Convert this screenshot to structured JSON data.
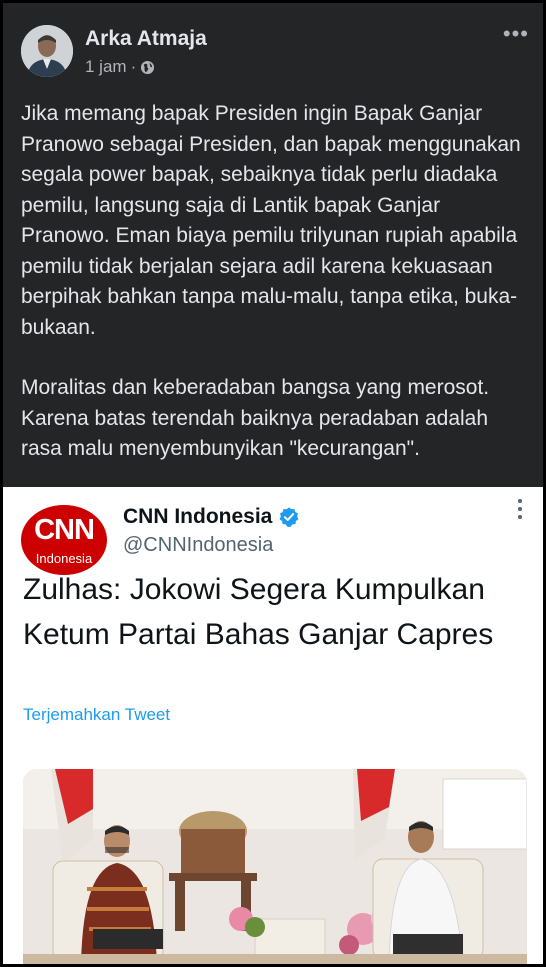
{
  "post": {
    "author": "Arka Atmaja",
    "time": "1 jam",
    "separator": "·",
    "privacy_icon": "public-globe-icon",
    "more_label": "•••",
    "paragraphs": [
      "Jika memang bapak Presiden ingin Bapak Ganjar Pranowo sebagai Presiden, dan bapak menggunakan segala power bapak, sebaiknya tidak perlu diadaka pemilu, langsung saja di Lantik bapak Ganjar Pranowo. Eman biaya pemilu trilyunan rupiah apabila pemilu tidak berjalan sejara adil karena kekuasaan berpihak bahkan tanpa malu-malu, tanpa etika, buka-bukaan.",
      "Moralitas dan keberadaban bangsa yang merosot. Karena batas terendah baiknya peradaban adalah rasa malu menyembunyikan \"kecurangan\"."
    ]
  },
  "tweet": {
    "logo_text": "CNN",
    "logo_subtext": "Indonesia",
    "name": "CNN Indonesia",
    "verified_icon": "verified-badge-icon",
    "handle": "@CNNIndonesia",
    "headline": "Zulhas: Jokowi Segera Kumpulkan Ketum Partai Bahas Ganjar Capres",
    "translate_label": "Terjemahkan Tweet",
    "photo_description_icon": "news-photo-image"
  },
  "colors": {
    "post_bg": "#242526",
    "post_text": "#e4e6eb",
    "meta_text": "#b0b3b8",
    "cnn_red": "#cc0000",
    "twitter_blue": "#1d9bf0",
    "handle_gray": "#536471"
  }
}
